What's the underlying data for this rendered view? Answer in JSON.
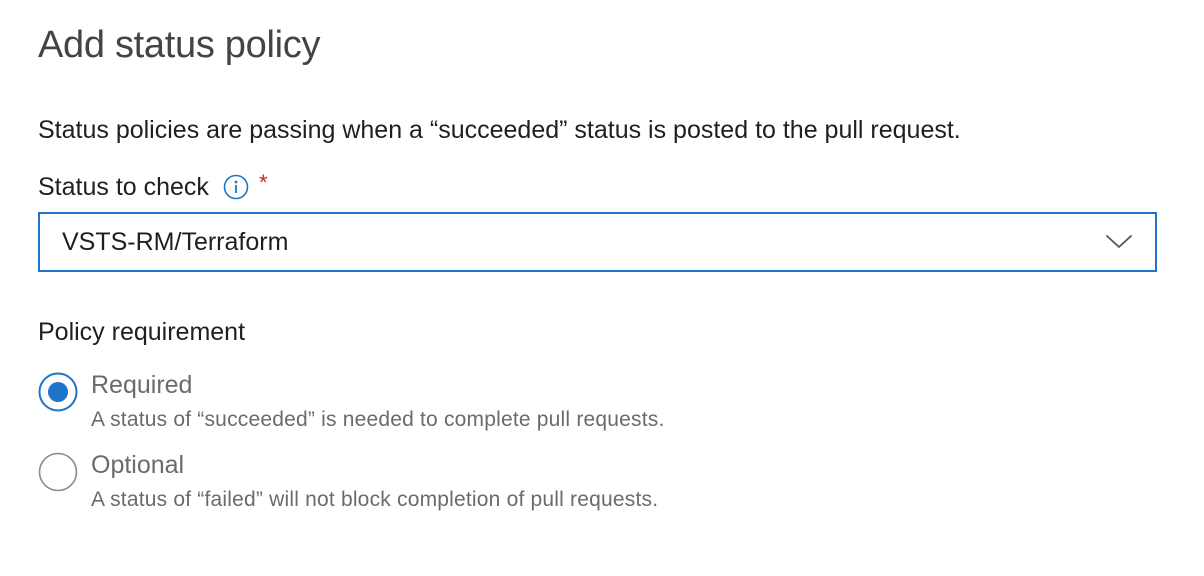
{
  "dialog": {
    "title": "Add status policy",
    "description": "Status policies are passing when a “succeeded” status is posted to the pull request."
  },
  "status_field": {
    "label": "Status to check",
    "info_icon": "info-icon",
    "required_marker": "*",
    "selected_value": "VSTS-RM/Terraform",
    "dropdown_icon": "chevron-down-icon"
  },
  "policy_requirement": {
    "label": "Policy requirement",
    "options": [
      {
        "title": "Required",
        "description": "A status of “succeeded” is needed to complete pull requests.",
        "selected": true
      },
      {
        "title": "Optional",
        "description": "A status of “failed” will not block completion of pull requests.",
        "selected": false
      }
    ]
  },
  "colors": {
    "accent": "#1d74c9",
    "required_star": "#c4262e",
    "muted_text": "#6b6b6b"
  }
}
